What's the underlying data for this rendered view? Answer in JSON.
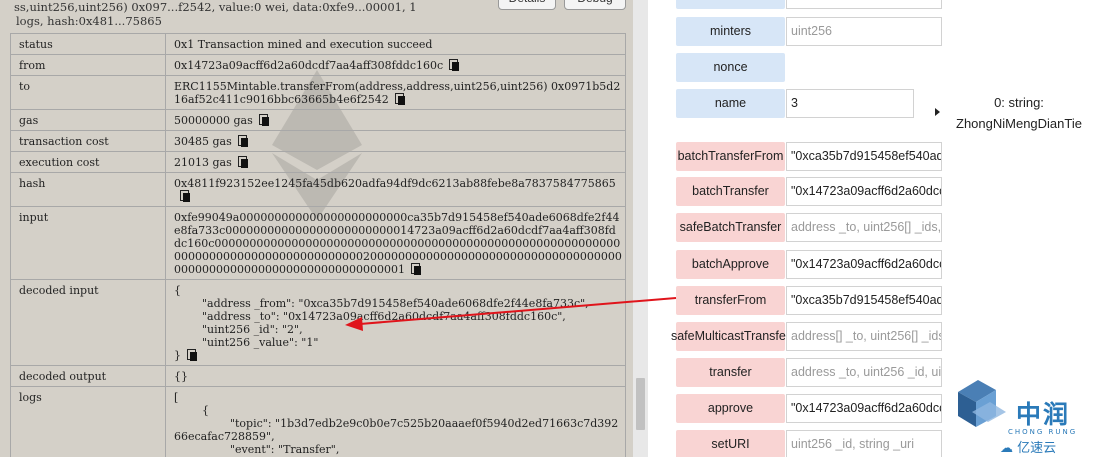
{
  "console": {
    "summary_line1": "ss,uint256,uint256) 0x097...f2542, value:0 wei, data:0xfe9...00001, 1",
    "summary_line2": "logs, hash:0x481...75865",
    "details_button": "Details",
    "debug_button": "Debug",
    "rows": [
      {
        "key": "status",
        "value": "0x1 Transaction mined and execution succeed",
        "copy": false
      },
      {
        "key": "from",
        "value": "0x14723a09acff6d2a60dcdf7aa4aff308fddc160c",
        "copy": true
      },
      {
        "key": "to",
        "value": "ERC1155Mintable.transferFrom(address,address,uint256,uint256) 0x0971b5d216af52c411c9016bbc63665b4e6f2542",
        "copy": true
      },
      {
        "key": "gas",
        "value": "50000000 gas",
        "copy": true
      },
      {
        "key": "transaction cost",
        "value": "30485 gas",
        "copy": true
      },
      {
        "key": "execution cost",
        "value": "21013 gas",
        "copy": true
      },
      {
        "key": "hash",
        "value": "0x4811f923152ee1245fa45db620adfa94df9dc6213ab88febe8a7837584775865",
        "copy": true
      },
      {
        "key": "input",
        "value": "0xfe99049a000000000000000000000000ca35b7d915458ef540ade6068dfe2f44e8fa733c000000000000000000000000014723a09acff6d2a60dcdf7aa4aff308fddc160c00000000000000000000000000000000000000000000000000000000000000000000000000000000000002000000000000000000000000000000000000000000000000000000000000000000001",
        "copy": true
      },
      {
        "key": "decoded input",
        "value": "{\n        \"address _from\": \"0xca35b7d915458ef540ade6068dfe2f44e8fa733c\",\n        \"address _to\": \"0x14723a09acff6d2a60dcdf7aa4aff308fddc160c\",\n        \"uint256 _id\": \"2\",\n        \"uint256 _value\": \"1\"\n}",
        "copy": true
      },
      {
        "key": "decoded output",
        "value": "{}",
        "copy": false
      },
      {
        "key": "logs",
        "value": "[\n        {\n                \"topic\": \"1b3d7edb2e9c0b0e7c525b20aaaef0f5940d2ed71663c7d39266ecafac728859\",\n                \"event\": \"Transfer\",\n                \"args\": [",
        "copy": false
      }
    ]
  },
  "functions": [
    {
      "label": "minters",
      "kind": "call",
      "value": "uint256",
      "placeholder": true
    },
    {
      "label": "nonce",
      "kind": "call",
      "value": "",
      "placeholder": false
    },
    {
      "label": "name",
      "kind": "call",
      "value": "3",
      "placeholder": false
    },
    {
      "label": "batchTransferFrom",
      "kind": "tx",
      "value": "\"0xca35b7d915458ef540ad",
      "placeholder": false
    },
    {
      "label": "batchTransfer",
      "kind": "tx",
      "value": "\"0x14723a09acff6d2a60dcc",
      "placeholder": false
    },
    {
      "label": "safeBatchTransfer",
      "kind": "tx",
      "value": "address _to, uint256[] _ids,",
      "placeholder": true
    },
    {
      "label": "batchApprove",
      "kind": "tx",
      "value": "\"0x14723a09acff6d2a60dcc",
      "placeholder": false
    },
    {
      "label": "transferFrom",
      "kind": "tx",
      "value": "\"0xca35b7d915458ef540ad",
      "placeholder": false
    },
    {
      "label": "safeMulticastTransfer",
      "kind": "tx",
      "value": "address[] _to, uint256[] _ids",
      "placeholder": true
    },
    {
      "label": "transfer",
      "kind": "tx",
      "value": "address _to, uint256 _id, uir",
      "placeholder": true
    },
    {
      "label": "approve",
      "kind": "tx",
      "value": "\"0x14723a09acff6d2a60dcc",
      "placeholder": false
    },
    {
      "label": "setURI",
      "kind": "tx",
      "value": "uint256 _id, string _uri",
      "placeholder": true
    }
  ],
  "output": {
    "line1": "0: string:",
    "line2": "ZhongNiMengDianTie"
  },
  "watermark": {
    "brand_cn": "中润",
    "brand_sub": "CHONG RUNG",
    "site": "亿速云"
  },
  "colors": {
    "call_button": "#d7e6f7",
    "tx_button": "#f9d4d3",
    "arrow": "#e0141b",
    "logo": "#2a7ab9"
  }
}
